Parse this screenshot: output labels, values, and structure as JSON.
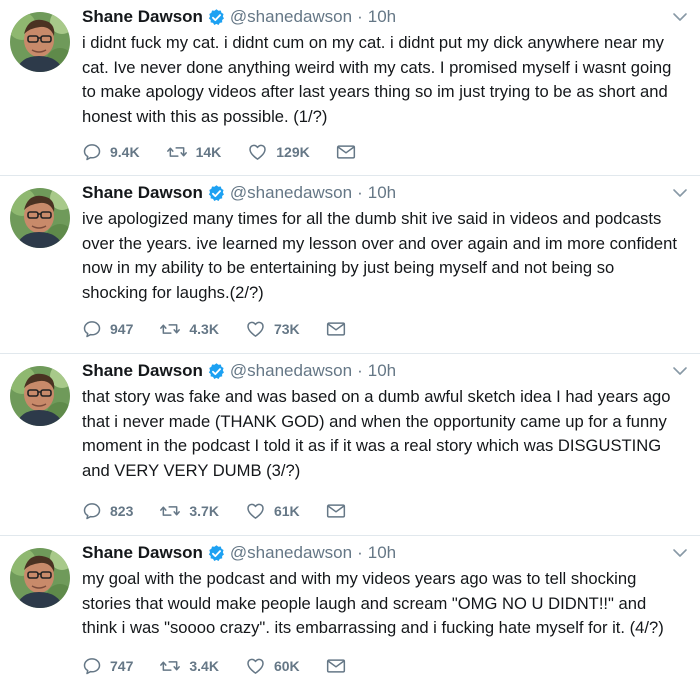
{
  "colors": {
    "text": "#14171a",
    "muted": "#657786",
    "verified": "#1da1f2",
    "divider": "#e1e8ed"
  },
  "tweets": [
    {
      "name": "Shane Dawson",
      "handle": "@shanedawson",
      "separator": "·",
      "time": "10h",
      "text": "i didnt fuck my cat. i didnt cum on my cat. i didnt put my dick anywhere near my\ncat. Ive never done anything weird with my cats. I promised myself i wasnt going\nto make apology videos after last years thing so im just trying to be as short and\nhonest with this as possible. (1/?)",
      "replies": "9.4K",
      "retweets": "14K",
      "likes": "129K"
    },
    {
      "name": "Shane Dawson",
      "handle": "@shanedawson",
      "separator": "·",
      "time": "10h",
      "text": "ive apologized many times for all the dumb shit ive said in videos and podcasts\nover the years. ive learned my lesson over and over again and im more confident\nnow in my ability to be entertaining by just being myself and not being so\nshocking for laughs.(2/?)",
      "replies": "947",
      "retweets": "4.3K",
      "likes": "73K"
    },
    {
      "name": "Shane Dawson",
      "handle": "@shanedawson",
      "separator": "·",
      "time": "10h",
      "text": "that story was fake and was based on a dumb awful sketch idea I had years ago\nthat i never made (THANK GOD) and when the opportunity came up for a funny\nmoment in the podcast I told it as if it was a real story which was DISGUSTING\nand VERY VERY DUMB (3/?)",
      "replies": "823",
      "retweets": "3.7K",
      "likes": "61K"
    },
    {
      "name": "Shane Dawson",
      "handle": "@shanedawson",
      "separator": "·",
      "time": "10h",
      "text": "my goal with the podcast and with my videos years ago was to tell shocking\nstories that would make people laugh and scream \"OMG NO U DIDNT!!\" and\nthink i was \"soooo crazy\". its embarrassing and i fucking hate myself for it. (4/?)",
      "replies": "747",
      "retweets": "3.4K",
      "likes": "60K"
    }
  ]
}
